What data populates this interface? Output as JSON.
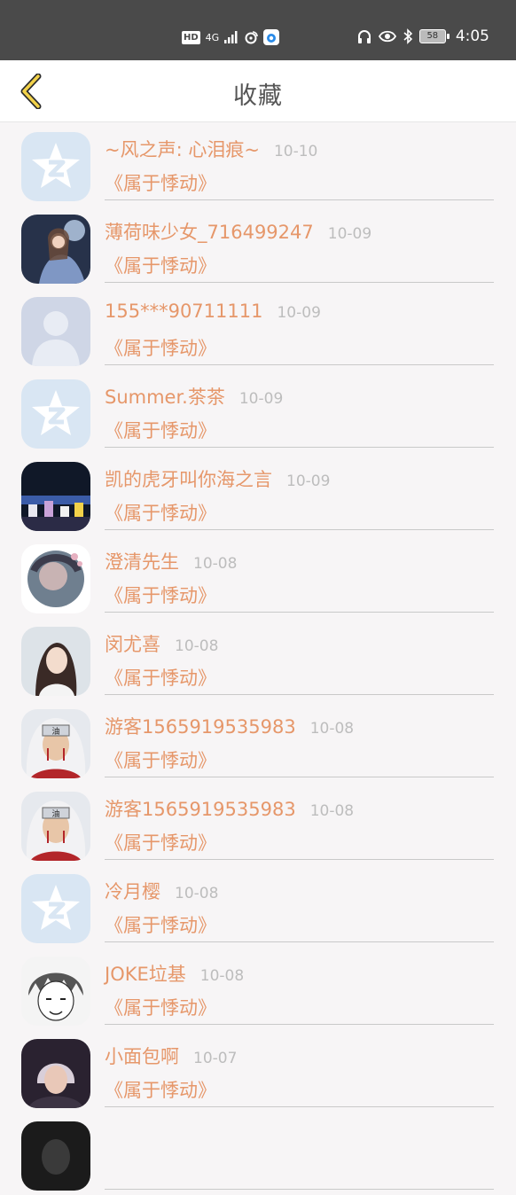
{
  "status_bar": {
    "network_badge": "HD",
    "signal_label": "4G",
    "battery": "58",
    "time": "4:05"
  },
  "header": {
    "title": "收藏"
  },
  "items": [
    {
      "name": "~风之声: 心泪痕~",
      "date": "10-10",
      "title": "《属于悸动》",
      "avatar": "qq-default"
    },
    {
      "name": "薄荷味少女_716499247",
      "date": "10-09",
      "title": "《属于悸动》",
      "avatar": "photo-anime-girl"
    },
    {
      "name": "155***90711111",
      "date": "10-09",
      "title": "《属于悸动》",
      "avatar": "silhouette-default"
    },
    {
      "name": "Summer.茶茶",
      "date": "10-09",
      "title": "《属于悸动》",
      "avatar": "qq-default"
    },
    {
      "name": "凯的虎牙叫你海之言",
      "date": "10-09",
      "title": "《属于悸动》",
      "avatar": "photo-stage"
    },
    {
      "name": "澄清先生",
      "date": "10-08",
      "title": "《属于悸动》",
      "avatar": "photo-circle-portrait"
    },
    {
      "name": "闵尤喜",
      "date": "10-08",
      "title": "《属于悸动》",
      "avatar": "photo-girl"
    },
    {
      "name": "游客1565919535983",
      "date": "10-08",
      "title": "《属于悸动》",
      "avatar": "photo-jiraiya"
    },
    {
      "name": "游客1565919535983",
      "date": "10-08",
      "title": "《属于悸动》",
      "avatar": "photo-jiraiya"
    },
    {
      "name": "冷月樱",
      "date": "10-08",
      "title": "《属于悸动》",
      "avatar": "qq-default"
    },
    {
      "name": "JOKE垃基",
      "date": "10-08",
      "title": "《属于悸动》",
      "avatar": "photo-manga-boy"
    },
    {
      "name": "小面包啊",
      "date": "10-07",
      "title": "《属于悸动》",
      "avatar": "photo-dark-portrait"
    },
    {
      "name": "",
      "date": "",
      "title": "",
      "avatar": "photo-dark"
    }
  ],
  "colors": {
    "accent": "#e6976a",
    "date": "#bdbdbd",
    "background": "#f7f5f6",
    "back_arrow": "#f2d24a"
  }
}
